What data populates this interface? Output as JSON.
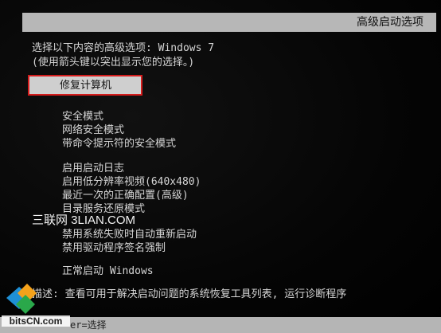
{
  "header": {
    "title": "高级启动选项"
  },
  "prompt": {
    "line1": "选择以下内容的高级选项: Windows 7",
    "line2": "(使用箭头键以突出显示您的选择。)"
  },
  "selected_option": "修复计算机",
  "options_group1": [
    "安全模式",
    "网络安全模式",
    "带命令提示符的安全模式"
  ],
  "options_group2": [
    "启用启动日志",
    "启用低分辨率视频(640x480)",
    "最近一次的正确配置(高级)",
    "目录服务还原模式",
    "禁用系统失败时自动重新启动",
    "禁用驱动程序签名强制"
  ],
  "options_group3": [
    "正常启动 Windows"
  ],
  "watermark": "三联网 3LIAN.COM",
  "description": "描述: 查看可用于解决启动问题的系统恢复工具列表, 运行诊断程序",
  "footer": {
    "hint": "er=选择"
  },
  "logo": {
    "text": "bitsCN.com"
  },
  "colors": {
    "highlight_border": "#d41c1c",
    "title_bar": "#b7b7b7",
    "text": "#d6d6d6",
    "background": "#050505"
  }
}
